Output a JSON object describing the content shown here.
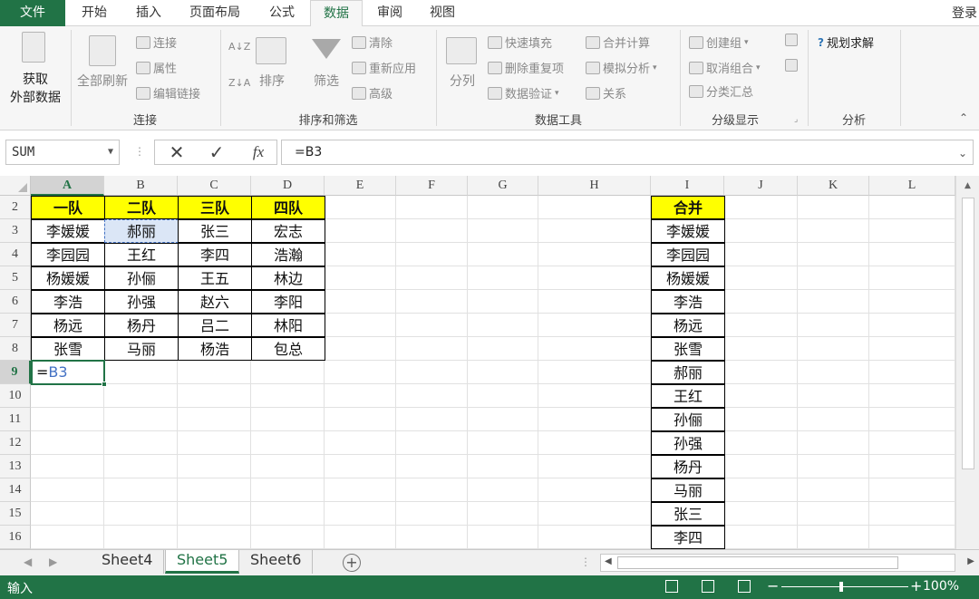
{
  "ribbon": {
    "tabs": [
      "文件",
      "开始",
      "插入",
      "页面布局",
      "公式",
      "数据",
      "审阅",
      "视图"
    ],
    "active_tab": "数据",
    "login": "登录",
    "groups": {
      "get_external": {
        "line1": "获取",
        "line2": "外部数据"
      },
      "connections": {
        "refresh_all": "全部刷新",
        "connections": "连接",
        "properties": "属性",
        "edit_links": "编辑链接",
        "label": "连接"
      },
      "sort_filter": {
        "sort_az": "A↓Z",
        "sort_za": "Z↓A",
        "sort": "排序",
        "filter": "筛选",
        "clear": "清除",
        "reapply": "重新应用",
        "advanced": "高级",
        "label": "排序和筛选"
      },
      "data_tools": {
        "text_to_columns": "分列",
        "flash_fill": "快速填充",
        "remove_dup": "删除重复项",
        "validation": "数据验证",
        "consolidate": "合并计算",
        "what_if": "模拟分析",
        "relationships": "关系",
        "label": "数据工具"
      },
      "outline": {
        "group": "创建组",
        "ungroup": "取消组合",
        "subtotal": "分类汇总",
        "label": "分级显示"
      },
      "analysis": {
        "solver": "规划求解",
        "label": "分析"
      }
    }
  },
  "formula_bar": {
    "name_box": "SUM",
    "cancel_icon": "✕",
    "enter_icon": "✓",
    "fx": "fx",
    "formula": "=B3"
  },
  "columns": [
    "A",
    "B",
    "C",
    "D",
    "E",
    "F",
    "G",
    "H",
    "I",
    "J",
    "K",
    "L"
  ],
  "rows": [
    "2",
    "3",
    "4",
    "5",
    "6",
    "7",
    "8",
    "9",
    "10",
    "11",
    "12",
    "13",
    "14",
    "15",
    "16"
  ],
  "table": {
    "headers": [
      "一队",
      "二队",
      "三队",
      "四队"
    ],
    "rows": [
      [
        "李媛媛",
        "郝丽",
        "张三",
        "宏志"
      ],
      [
        "李园园",
        "王红",
        "李四",
        "浩瀚"
      ],
      [
        "杨媛媛",
        "孙俪",
        "王五",
        "林边"
      ],
      [
        "李浩",
        "孙强",
        "赵六",
        "李阳"
      ],
      [
        "杨远",
        "杨丹",
        "吕二",
        "林阳"
      ],
      [
        "张雪",
        "马丽",
        "杨浩",
        "包总"
      ]
    ]
  },
  "edit_cell": {
    "prefix": "=",
    "ref": "B3"
  },
  "merged": {
    "header": "合并",
    "values": [
      "李媛媛",
      "李园园",
      "杨媛媛",
      "李浩",
      "杨远",
      "张雪",
      "郝丽",
      "王红",
      "孙俪",
      "孙强",
      "杨丹",
      "马丽",
      "张三",
      "李四"
    ]
  },
  "sheets": [
    "Sheet4",
    "Sheet5",
    "Sheet6"
  ],
  "active_sheet": "Sheet5",
  "status": {
    "mode": "输入",
    "zoom": "100%"
  },
  "colors": {
    "accent": "#217346",
    "header_fill": "#ffff00",
    "ref_blue": "#4472c4"
  }
}
